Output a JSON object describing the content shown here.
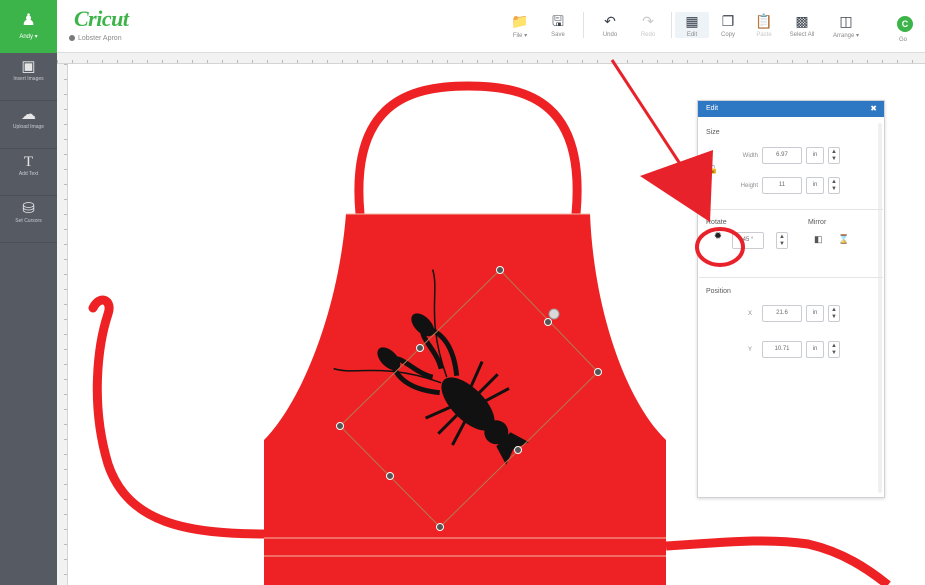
{
  "sidebar": {
    "user_label": "Andy ▾",
    "items": [
      {
        "label": "Insert Images"
      },
      {
        "label": "Upload Image"
      },
      {
        "label": "Add Text"
      },
      {
        "label": "Set Cursors"
      }
    ]
  },
  "header": {
    "logo": "Cricut",
    "project_name": "Lobster Apron",
    "toolbar": [
      {
        "label": "File ▾"
      },
      {
        "label": "Save"
      },
      {
        "label": "Undo"
      },
      {
        "label": "Redo"
      },
      {
        "label": "Edit"
      },
      {
        "label": "Copy"
      },
      {
        "label": "Paste"
      },
      {
        "label": "Select All"
      },
      {
        "label": "Arrange ▾"
      },
      {
        "label": "Go"
      }
    ],
    "go_glyph": "C"
  },
  "panel": {
    "title": "Edit",
    "close": "✖",
    "size": {
      "title": "Size",
      "width_label": "Width",
      "width_value": "6.97",
      "height_label": "Height",
      "height_value": "11",
      "unit": "in"
    },
    "rotate": {
      "title": "Rotate",
      "value": "45 °"
    },
    "mirror": {
      "title": "Mirror"
    },
    "position": {
      "title": "Position",
      "x_label": "X",
      "x_value": "21.6",
      "y_label": "Y",
      "y_value": "10.71",
      "unit": "in"
    }
  },
  "colors": {
    "brand": "#3db44a",
    "panel_header": "#2e77c2",
    "apron": "#ee2224",
    "annotation": "#e8222a"
  }
}
